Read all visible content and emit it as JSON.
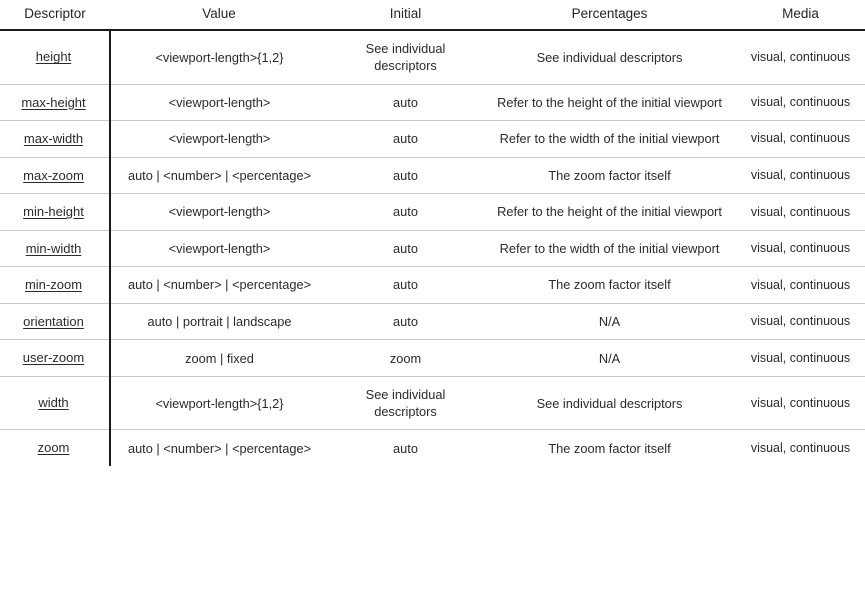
{
  "table": {
    "columns": [
      {
        "key": "descriptor",
        "label": "Descriptor"
      },
      {
        "key": "value",
        "label": "Value"
      },
      {
        "key": "initial",
        "label": "Initial"
      },
      {
        "key": "percentages",
        "label": "Percentages"
      },
      {
        "key": "media",
        "label": "Media"
      }
    ],
    "rows": [
      {
        "descriptor": "height",
        "value": "<viewport-length>{1,2}",
        "initial": "See individual descriptors",
        "percentages": "See individual descriptors",
        "media": "visual, continuous"
      },
      {
        "descriptor": "max-height",
        "value": "<viewport-length>",
        "initial": "auto",
        "percentages": "Refer to the height of the initial viewport",
        "media": "visual, continuous"
      },
      {
        "descriptor": "max-width",
        "value": "<viewport-length>",
        "initial": "auto",
        "percentages": "Refer to the width of the initial viewport",
        "media": "visual, continuous"
      },
      {
        "descriptor": "max-zoom",
        "value": "auto | <number> | <percentage>",
        "initial": "auto",
        "percentages": "The zoom factor itself",
        "media": "visual, continuous"
      },
      {
        "descriptor": "min-height",
        "value": "<viewport-length>",
        "initial": "auto",
        "percentages": "Refer to the height of the initial viewport",
        "media": "visual, continuous"
      },
      {
        "descriptor": "min-width",
        "value": "<viewport-length>",
        "initial": "auto",
        "percentages": "Refer to the width of the initial viewport",
        "media": "visual, continuous"
      },
      {
        "descriptor": "min-zoom",
        "value": "auto | <number> | <percentage>",
        "initial": "auto",
        "percentages": "The zoom factor itself",
        "media": "visual, continuous"
      },
      {
        "descriptor": "orientation",
        "value": "auto | portrait | landscape",
        "initial": "auto",
        "percentages": "N/A",
        "media": "visual, continuous"
      },
      {
        "descriptor": "user-zoom",
        "value": "zoom | fixed",
        "initial": "zoom",
        "percentages": "N/A",
        "media": "visual, continuous"
      },
      {
        "descriptor": "width",
        "value": "<viewport-length>{1,2}",
        "initial": "See individual descriptors",
        "percentages": "See individual descriptors",
        "media": "visual, continuous"
      },
      {
        "descriptor": "zoom",
        "value": "auto | <number> | <percentage>",
        "initial": "auto",
        "percentages": "The zoom factor itself",
        "media": "visual, continuous"
      }
    ]
  },
  "colors": {
    "text": "#2b2b2b",
    "rule_strong": "#1a1a1a",
    "rule_light": "#c9c9c9",
    "background": "#ffffff"
  }
}
